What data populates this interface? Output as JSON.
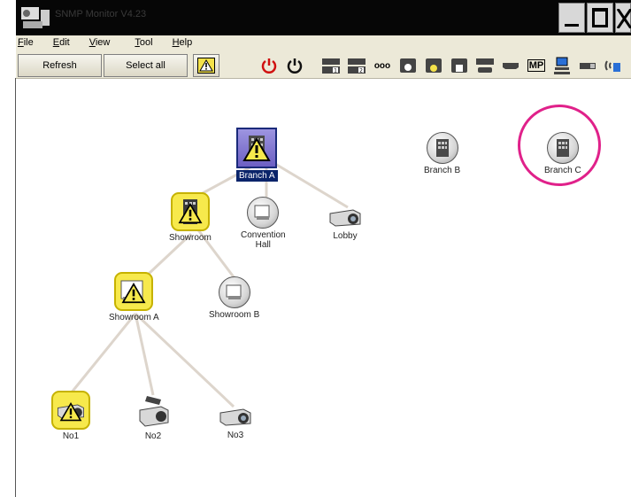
{
  "window": {
    "title": "SNMP Monitor V4.23"
  },
  "menu": [
    {
      "first": "F",
      "rest": "ile"
    },
    {
      "first": "E",
      "rest": "dit"
    },
    {
      "first": "V",
      "rest": "iew"
    },
    {
      "first": "T",
      "rest": "ool"
    },
    {
      "first": "H",
      "rest": "elp"
    }
  ],
  "toolbar": {
    "refresh_label": "Refresh",
    "select_all_label": "Select all",
    "icon_buttons": [
      "power-on",
      "power-off",
      "input-1",
      "input-2",
      "ooo",
      "input-s",
      "input-video",
      "input-card",
      "vga",
      "hdmi",
      "mp",
      "network",
      "usb",
      "wireless"
    ],
    "mp_label": "MP",
    "ooo_label": "ooo"
  },
  "nodes": {
    "branch_a": "Branch A",
    "branch_b": "Branch B",
    "branch_c": "Branch C",
    "showroom": "Showroom",
    "convention": "Convention\nHall",
    "lobby": "Lobby",
    "showroom_a": "Showroom A",
    "showroom_b": "Showroom B",
    "no1": "No1",
    "no2": "No2",
    "no3": "No3"
  },
  "colors": {
    "highlight_circle": "#e0218a",
    "warning_bg": "#f7e94c",
    "selection": "#0a246a"
  }
}
